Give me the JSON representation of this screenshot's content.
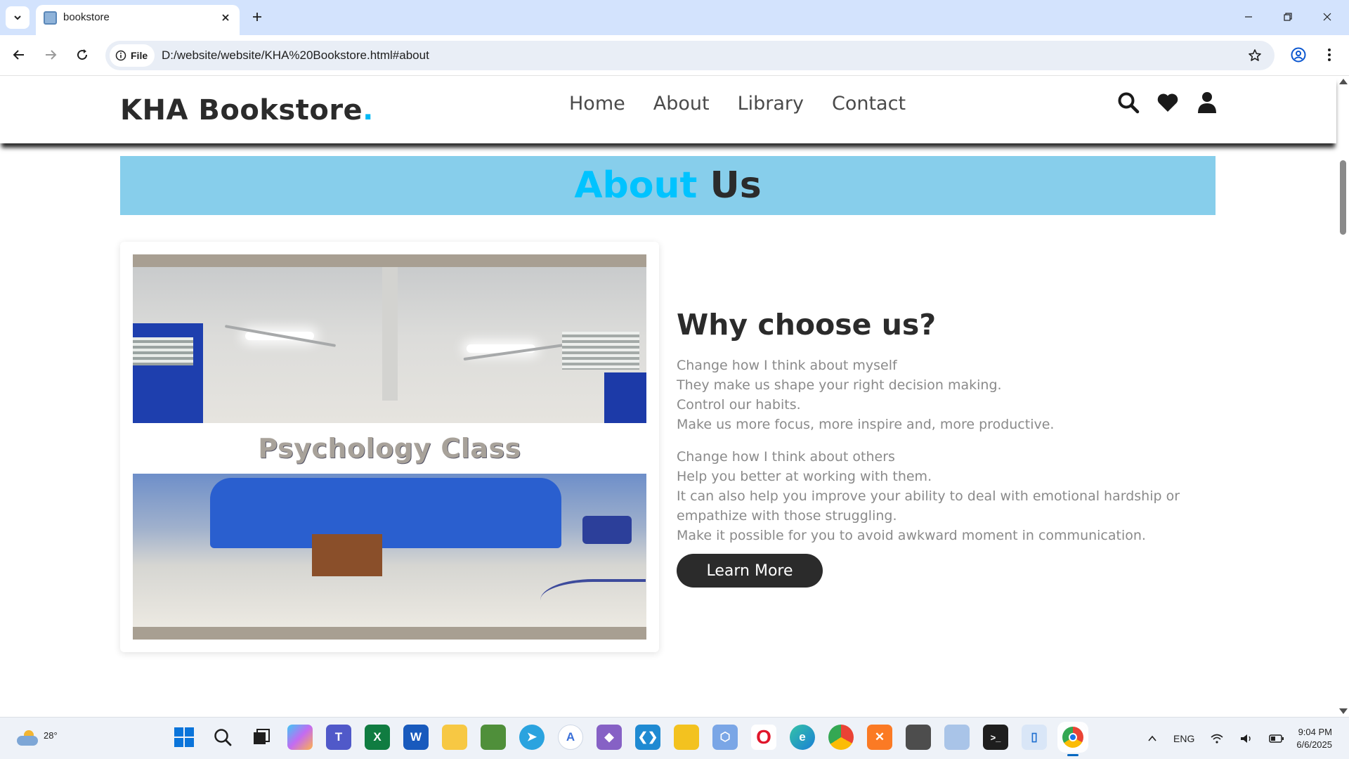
{
  "browser": {
    "tab_title": "bookstore",
    "site_chip_label": "File",
    "url": "D:/website/website/KHA%20Bookstore.html#about"
  },
  "header": {
    "logo_text": "KHA Bookstore",
    "logo_dot": ".",
    "nav": [
      "Home",
      "About",
      "Library",
      "Contact"
    ],
    "icons": [
      "search-icon",
      "heart-icon",
      "user-icon"
    ]
  },
  "about": {
    "title_highlight": "About",
    "title_rest": "Us",
    "image_caption": "Psychology Class",
    "heading": "Why choose us?",
    "paragraph1": [
      "Change how I think about myself",
      "They make us shape your right decision making.",
      "Control our habits.",
      "Make us more focus, more inspire and, more productive."
    ],
    "paragraph2": [
      "Change how I think about others",
      "Help you better at working with them.",
      "It can also help you improve your ability to deal with emotional hardship or",
      "empathize with those struggling.",
      "Make it possible for you to avoid awkward moment in communication."
    ],
    "button_label": "Learn More"
  },
  "colors": {
    "accent": "#00c3ff",
    "banner_bg": "#87ceeb",
    "dark": "#2b2b2b"
  },
  "taskbar": {
    "weather_temp": "28°",
    "language": "ENG",
    "time": "9:04 PM",
    "date": "6/6/2025",
    "apps": [
      "start-icon",
      "search-icon",
      "task-view-icon",
      "copilot-icon",
      "teams-icon",
      "excel-icon",
      "word-icon",
      "file-explorer-icon",
      "app-icon",
      "telegram-icon",
      "app-icon",
      "visual-studio-icon",
      "vscode-icon",
      "app-icon",
      "app-icon",
      "opera-icon",
      "edge-icon",
      "chrome-icon",
      "xampp-icon",
      "app-icon",
      "app-icon",
      "terminal-icon",
      "app-icon",
      "chrome-icon"
    ]
  }
}
